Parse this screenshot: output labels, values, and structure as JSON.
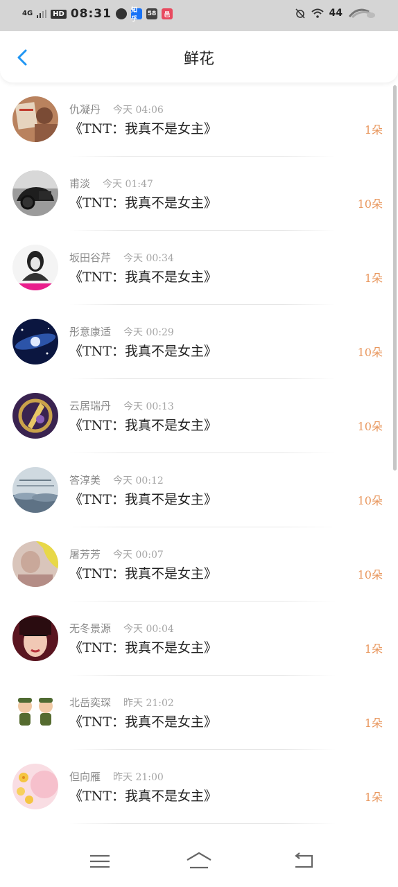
{
  "status_bar": {
    "network": "4G",
    "hd": "HD",
    "time": "08:31",
    "app_icons": [
      "navigation-icon",
      "zhihu-icon",
      "58-icon",
      "app-icon"
    ],
    "app_labels": [
      "",
      "知乎",
      "58",
      "邑"
    ],
    "battery": "44"
  },
  "header": {
    "title": "鲜花",
    "back_icon": "back-arrow-icon"
  },
  "gifts": [
    {
      "name": "仇凝丹",
      "time": "今天 04:06",
      "book": "《TNT：我真不是女主》",
      "count": "1朵"
    },
    {
      "name": "甫淡",
      "time": "今天 01:47",
      "book": "《TNT：我真不是女主》",
      "count": "10朵"
    },
    {
      "name": "坂田谷芹",
      "time": "今天 00:34",
      "book": "《TNT：我真不是女主》",
      "count": "1朵"
    },
    {
      "name": "彤意康适",
      "time": "今天 00:29",
      "book": "《TNT：我真不是女主》",
      "count": "10朵"
    },
    {
      "name": "云居瑞丹",
      "time": "今天 00:13",
      "book": "《TNT：我真不是女主》",
      "count": "10朵"
    },
    {
      "name": "答淳美",
      "time": "今天 00:12",
      "book": "《TNT：我真不是女主》",
      "count": "10朵"
    },
    {
      "name": "屠芳芳",
      "time": "今天 00:07",
      "book": "《TNT：我真不是女主》",
      "count": "10朵"
    },
    {
      "name": "无冬景源",
      "time": "今天 00:04",
      "book": "《TNT：我真不是女主》",
      "count": "1朵"
    },
    {
      "name": "北岳奕琛",
      "time": "昨天 21:02",
      "book": "《TNT：我真不是女主》",
      "count": "1朵"
    },
    {
      "name": "但向雁",
      "time": "昨天 21:00",
      "book": "《TNT：我真不是女主》",
      "count": "1朵"
    }
  ],
  "nav_bar": {
    "icons": [
      "menu-icon",
      "home-icon",
      "back-icon"
    ]
  },
  "colors": {
    "accent": "#2196f3",
    "count": "#e8965c",
    "status_bar_bg": "#d5d5d5"
  }
}
